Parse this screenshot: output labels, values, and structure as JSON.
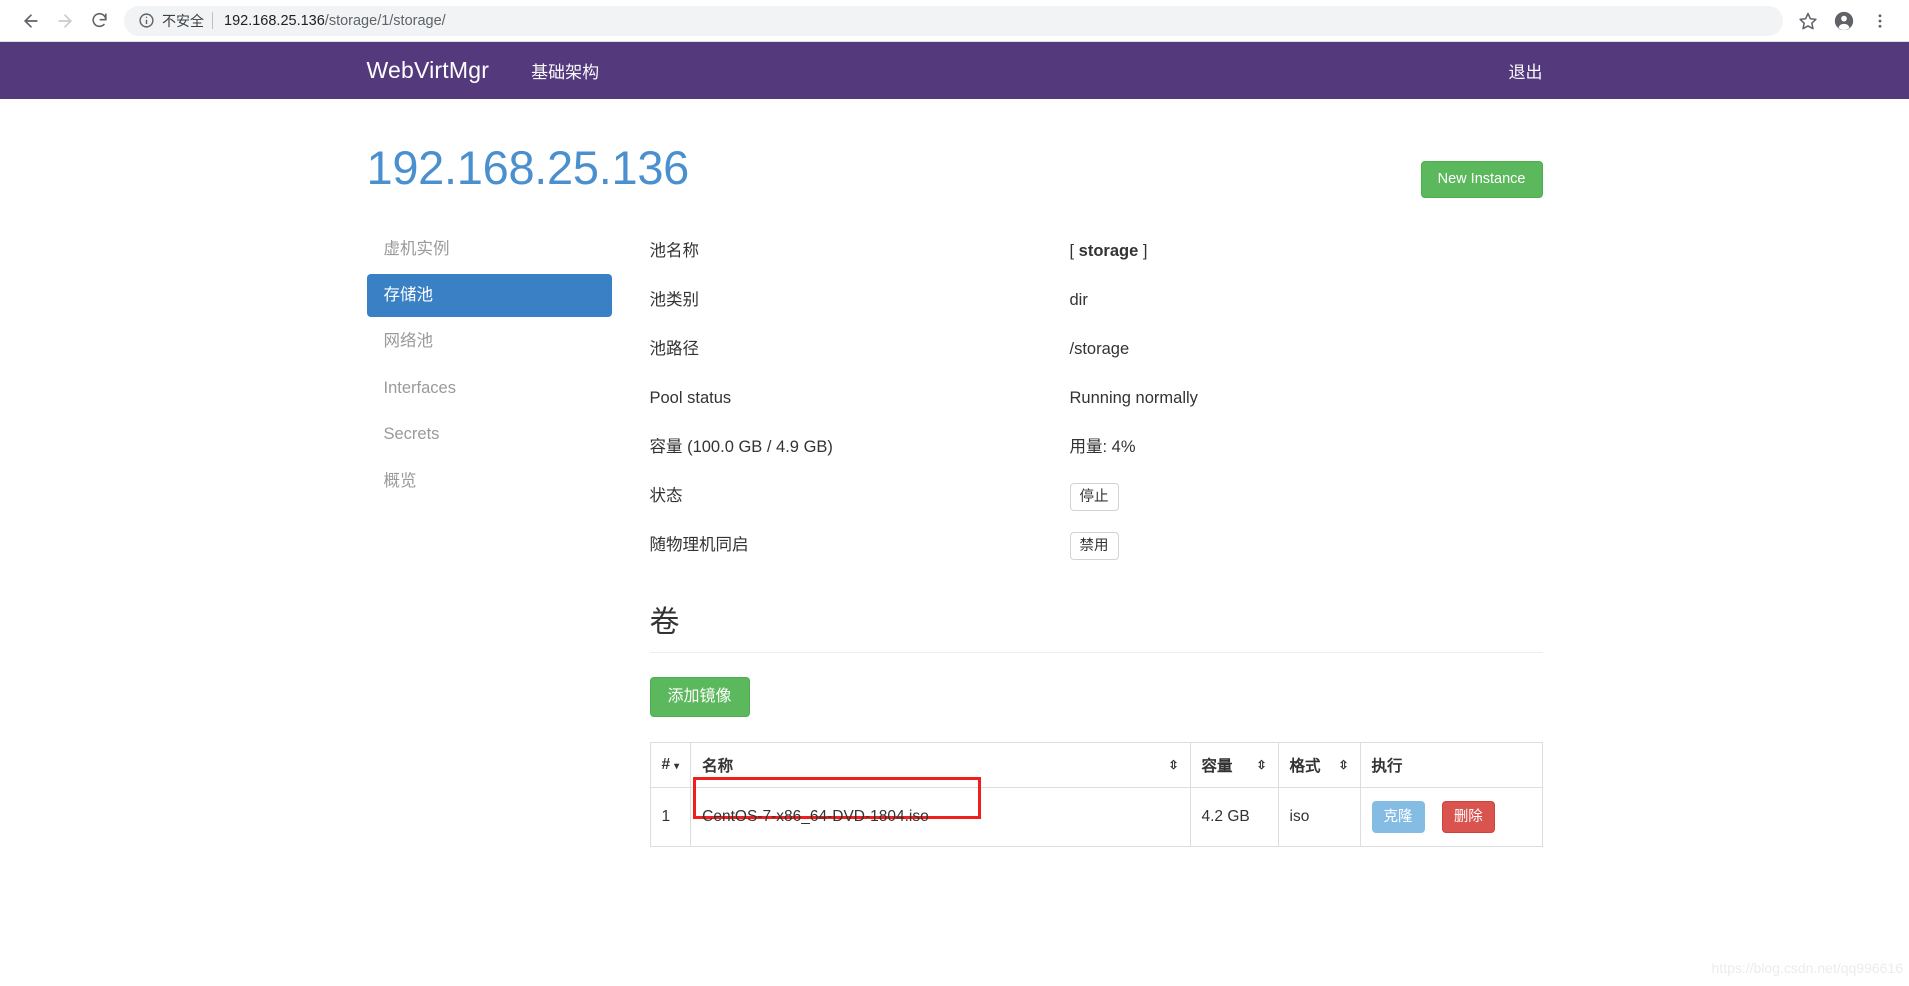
{
  "browser": {
    "back_icon": "back-arrow-icon",
    "forward_icon": "forward-arrow-icon",
    "reload_icon": "reload-icon",
    "info_icon": "info-circle-icon",
    "insecure_label": "不安全",
    "url_host": "192.168.25.136",
    "url_path": "/storage/1/storage/",
    "url_full": "192.168.25.136/storage/1/storage/",
    "bookmark_icon": "star-icon",
    "profile_icon": "account-avatar-icon",
    "menu_icon": "three-dot-menu-icon"
  },
  "navbar": {
    "brand": "WebVirtMgr",
    "links": [
      {
        "label": "基础架构"
      }
    ],
    "logout": "退出",
    "bg_color": "#54397c"
  },
  "header": {
    "title": "192.168.25.136",
    "title_color": "#4a90cf",
    "new_instance": "New Instance",
    "new_instance_color": "#5cb85c"
  },
  "sidebar": {
    "items": [
      {
        "label": "虚机实例",
        "active": false
      },
      {
        "label": "存储池",
        "active": true
      },
      {
        "label": "网络池",
        "active": false
      },
      {
        "label": "Interfaces",
        "active": false
      },
      {
        "label": "Secrets",
        "active": false
      },
      {
        "label": "概览",
        "active": false
      }
    ],
    "active_color": "#3a80c5"
  },
  "details": [
    {
      "label": "池名称",
      "value": "[ storage ]",
      "bold_value": "storage",
      "type": "bracketed"
    },
    {
      "label": "池类别",
      "value": "dir",
      "type": "text"
    },
    {
      "label": "池路径",
      "value": "/storage",
      "type": "text"
    },
    {
      "label": "Pool status",
      "value": "Running normally",
      "type": "text"
    },
    {
      "label": "容量 (100.0 GB / 4.9 GB)",
      "value": "用量: 4%",
      "type": "text"
    },
    {
      "label": "状态",
      "value": "停止",
      "type": "button"
    },
    {
      "label": "随物理机同启",
      "value": "禁用",
      "type": "button"
    }
  ],
  "volumes": {
    "section_title": "卷",
    "add_image_button": "添加镜像",
    "columns": [
      {
        "label": "#",
        "sort": "caret"
      },
      {
        "label": "名称",
        "sort": "updown"
      },
      {
        "label": "容量",
        "sort": "updown"
      },
      {
        "label": "格式",
        "sort": "updown"
      },
      {
        "label": "执行",
        "sort": "none"
      }
    ],
    "rows": [
      {
        "num": "1",
        "name": "CentOS-7-x86_64-DVD-1804.iso",
        "capacity": "4.2 GB",
        "format": "iso",
        "clone_label": "克隆",
        "delete_label": "删除",
        "highlighted": true
      }
    ],
    "clone_color": "#85bce3",
    "delete_color": "#d9534f",
    "highlight_color": "#f01f1f"
  },
  "watermark": "https://blog.csdn.net/qq996616"
}
